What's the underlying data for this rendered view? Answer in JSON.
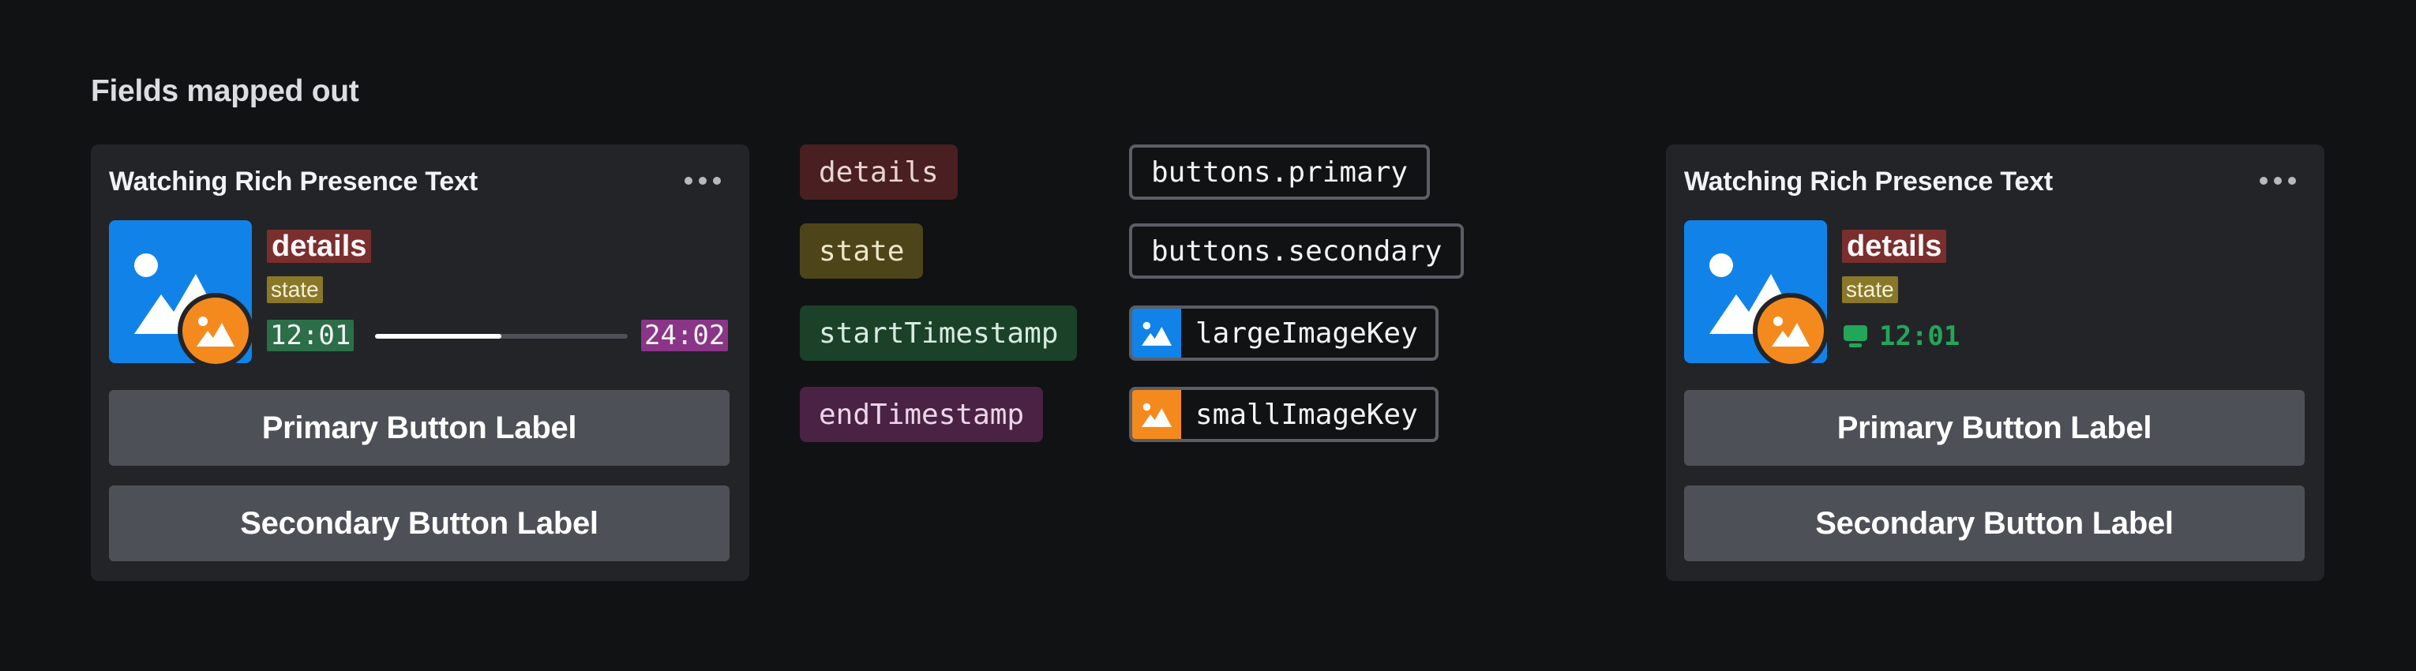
{
  "page": {
    "title": "Fields mapped out"
  },
  "left_card": {
    "header": "Watching Rich Presence Text",
    "details": "details",
    "state": "state",
    "start_timestamp": "12:01",
    "end_timestamp": "24:02",
    "progress_fraction": 0.5,
    "primary_button": "Primary Button Label",
    "secondary_button": "Secondary Button Label"
  },
  "right_card": {
    "header": "Watching Rich Presence Text",
    "details": "details",
    "state": "state",
    "elapsed": "12:01",
    "primary_button": "Primary Button Label",
    "secondary_button": "Secondary Button Label"
  },
  "legend": {
    "details": "details",
    "state": "state",
    "start_timestamp": "startTimestamp",
    "end_timestamp": "endTimestamp",
    "buttons_primary": "buttons.primary",
    "buttons_secondary": "buttons.secondary",
    "large_image_key": "largeImageKey",
    "small_image_key": "smallImageKey"
  },
  "colors": {
    "large_image": "#1183e8",
    "small_image": "#f48a1e",
    "details": "#7b2e2e",
    "state": "#8a7828",
    "start_timestamp": "#2c6e48",
    "end_timestamp": "#8a3587",
    "elapsed": "#23a55a"
  },
  "icons": [
    "more-options-icon",
    "image-icon",
    "gamepad-icon"
  ]
}
